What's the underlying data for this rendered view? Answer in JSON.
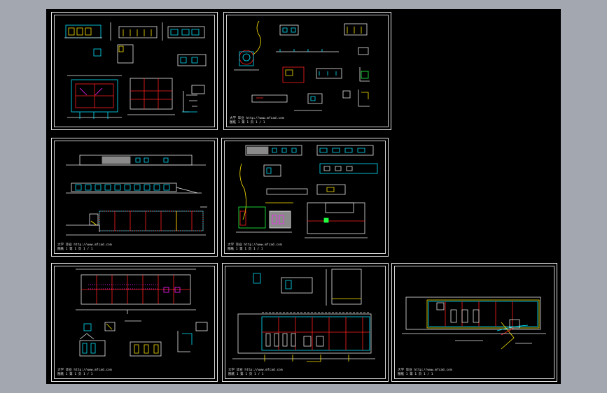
{
  "app": {
    "background_color": "#a3a8b0",
    "canvas_color": "#000000",
    "stroke_colors": {
      "white": "#e8e8e8",
      "cyan": "#00e5ff",
      "red": "#ff2020",
      "yellow": "#ffe600",
      "green": "#20ff40",
      "magenta": "#ff20ff",
      "gray": "#8a8a8a"
    }
  },
  "sheets": [
    {
      "id": "sheet-1",
      "title_block": {
        "line1": "",
        "line2": ""
      }
    },
    {
      "id": "sheet-2",
      "title_block": {
        "line1": "大学 毕业   http://www.mfcad.com",
        "line2": "图纸 1   第 1 页   1 / 1"
      }
    },
    {
      "id": "sheet-3",
      "title_block": {
        "line1": "大学 毕业   http://www.mfcad.com",
        "line2": "图纸 1   第 1 页   1 / 1"
      }
    },
    {
      "id": "sheet-4",
      "title_block": {
        "line1": "大学 毕业   http://www.mfcad.com",
        "line2": "图纸 1   第 1 页   1 / 1"
      }
    },
    {
      "id": "sheet-5",
      "title_block": {
        "line1": "大学 毕业   http://www.mfcad.com",
        "line2": "图纸 1   第 1 页   1 / 1"
      }
    },
    {
      "id": "sheet-6",
      "title_block": {
        "line1": "大学 毕业   http://www.mfcad.com",
        "line2": "图纸 1   第 1 页   1 / 1"
      }
    },
    {
      "id": "sheet-7",
      "title_block": {
        "line1": "大学 毕业   http://www.mfcad.com",
        "line2": "图纸 1   第 1 页   1 / 1"
      }
    }
  ]
}
